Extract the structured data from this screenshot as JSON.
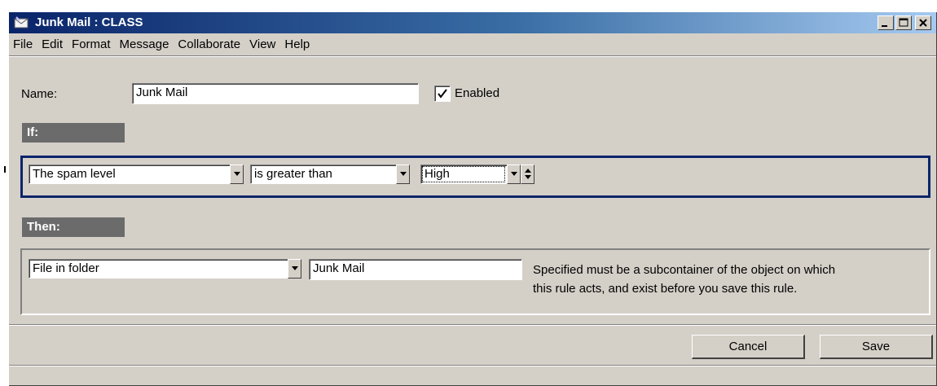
{
  "window": {
    "title": "Junk Mail : CLASS",
    "icon": "envelope-icon",
    "controls": [
      "minimize-icon",
      "maximize-icon",
      "close-icon"
    ]
  },
  "menu": [
    "File",
    "Edit",
    "Format",
    "Message",
    "Collaborate",
    "View",
    "Help"
  ],
  "form": {
    "name_label": "Name:",
    "name_value": "Junk Mail",
    "enabled_label": "Enabled",
    "enabled_checked": true
  },
  "if_section": {
    "heading": "If:",
    "condition_field": "The spam level",
    "operator": "is greater than",
    "value": "High"
  },
  "then_section": {
    "heading": "Then:",
    "action": "File in folder",
    "folder": "Junk Mail",
    "hint_line1": "Specified must be a subcontainer of the object on which",
    "hint_line2": "this rule acts, and  exist before you save this rule."
  },
  "buttons": {
    "cancel": "Cancel",
    "save": "Save"
  },
  "colors": {
    "title_start": "#0a246a",
    "title_end": "#a6caf0",
    "face": "#d4d0c8",
    "section_head": "#6b6b6b",
    "focus_border": "#0a246a"
  }
}
